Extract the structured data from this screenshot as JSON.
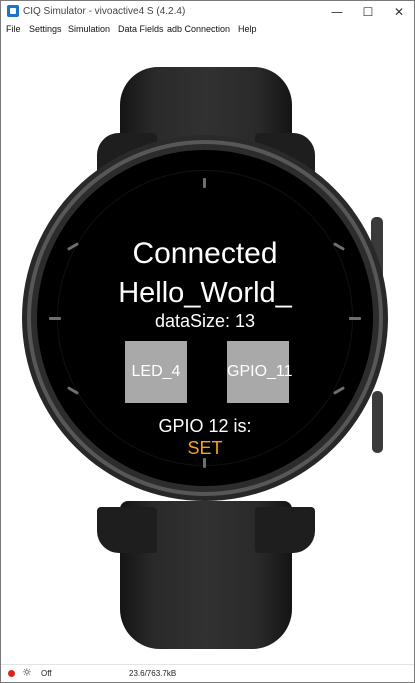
{
  "window": {
    "title": "CIQ Simulator - vivoactive4 S (4.2.4)",
    "minimize_glyph": "—",
    "maximize_glyph": "☐",
    "close_glyph": "✕"
  },
  "menu": {
    "items": [
      {
        "label": "File"
      },
      {
        "label": "Settings"
      },
      {
        "label": "Simulation"
      },
      {
        "label": "Data Fields"
      },
      {
        "label": "adb Connection"
      },
      {
        "label": "Help"
      }
    ]
  },
  "watch_face": {
    "status": "Connected",
    "app_name": "Hello_World_",
    "data_size": "dataSize: 13",
    "buttons": {
      "led": "LED_4",
      "gpio": "GPIO_11"
    },
    "gpio_label": "GPIO 12 is:",
    "gpio_state": "SET",
    "colors": {
      "text": "#ffffff",
      "state": "#f7a21b",
      "button": "#a9a9a9",
      "screen": "#000000"
    }
  },
  "statusbar": {
    "power_label": "Off",
    "memory": "23.6/763.7kB",
    "icons": [
      "record-icon",
      "sun-icon"
    ]
  }
}
